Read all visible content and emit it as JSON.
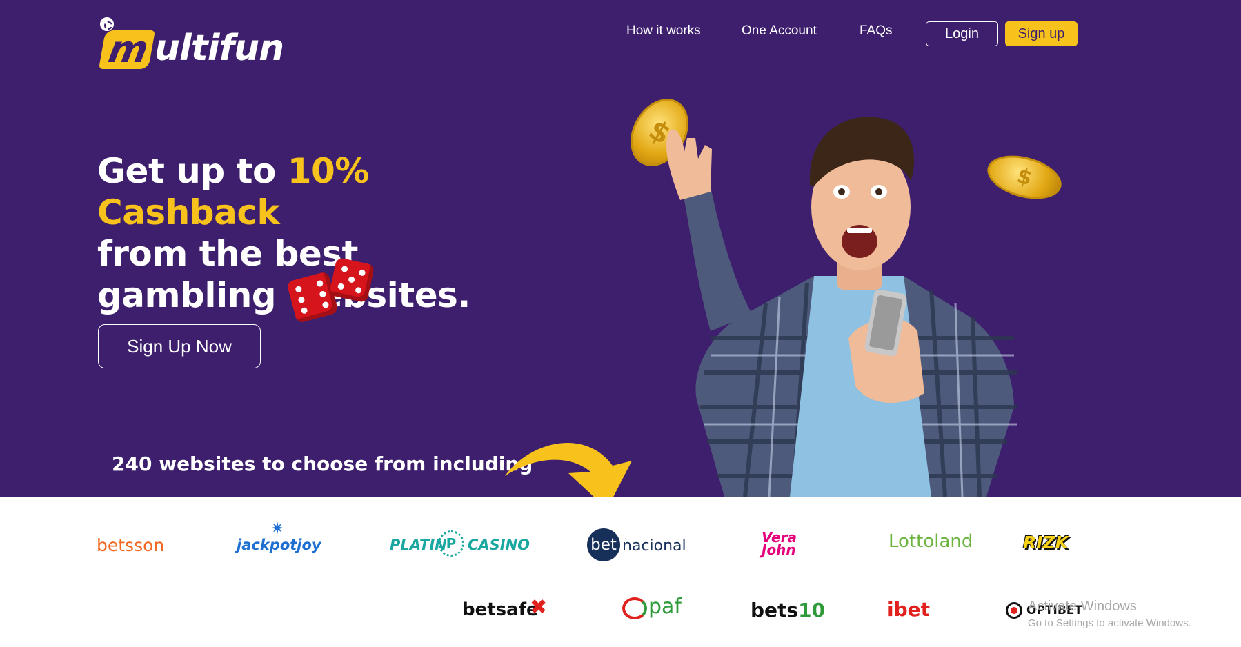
{
  "header": {
    "logo_text": "ultifun",
    "logo_letter": "m",
    "nav": [
      "How it works",
      "One Account",
      "FAQs"
    ],
    "login_label": "Login",
    "signup_label": "Sign up"
  },
  "hero": {
    "headline_pre": "Get up to ",
    "headline_accent": "10% Cashback",
    "headline_post": "from the best gambling websites.",
    "cta_label": "Sign Up Now",
    "count_text": "240 websites to choose from including"
  },
  "brands": {
    "row1": [
      "betsson",
      "jackpotjoy",
      "PLATIN",
      "CASINO",
      "bet",
      "nacional",
      "Vera",
      "John",
      "Lottoland",
      "RIZK"
    ],
    "row2": [
      "betsafe",
      "paf",
      "bets",
      "10",
      "ibet",
      "OPTIBET"
    ]
  },
  "watermark": {
    "title": "Activate Windows",
    "subtitle": "Go to Settings to activate Windows."
  },
  "colors": {
    "hero_bg": "#3d1f6d",
    "accent": "#f7c21b"
  }
}
